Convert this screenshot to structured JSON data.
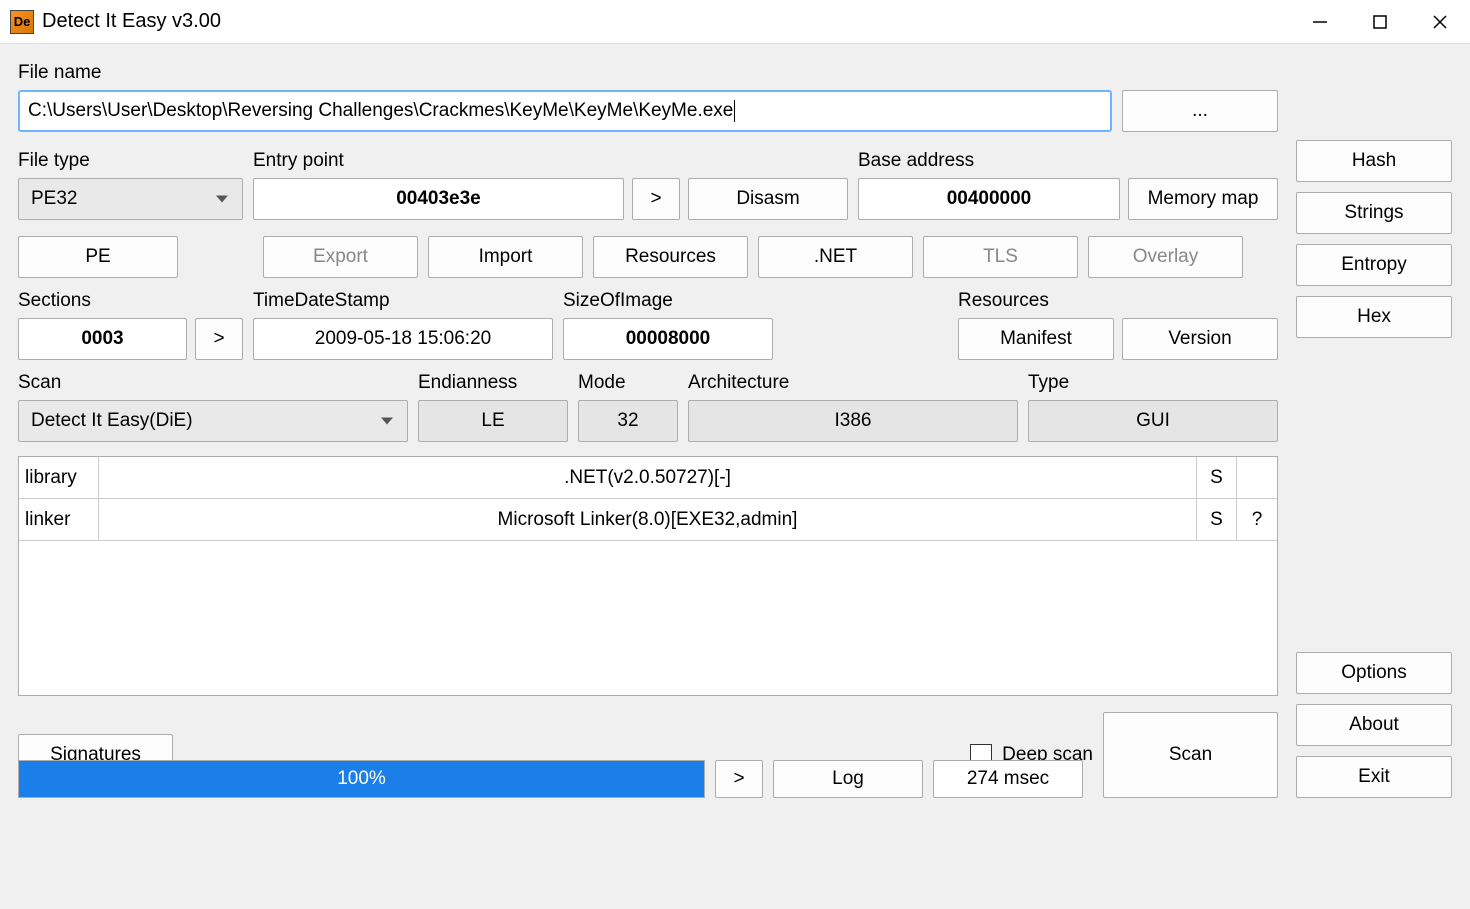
{
  "window": {
    "title": "Detect It Easy v3.00"
  },
  "filename_label": "File name",
  "filename_value": "C:\\Users\\User\\Desktop\\Reversing Challenges\\Crackmes\\KeyMe\\KeyMe\\KeyMe.exe",
  "browse_label": "...",
  "filetype_label": "File type",
  "filetype_value": "PE32",
  "entrypoint_label": "Entry point",
  "entrypoint_value": "00403e3e",
  "ep_more": ">",
  "disasm_label": "Disasm",
  "baseaddr_label": "Base address",
  "baseaddr_value": "00400000",
  "memmap_label": "Memory map",
  "pe_label": "PE",
  "export_label": "Export",
  "import_label": "Import",
  "resources_btn_label": "Resources",
  "net_label": ".NET",
  "tls_label": "TLS",
  "overlay_label": "Overlay",
  "sections_label": "Sections",
  "sections_value": "0003",
  "sections_more": ">",
  "timedate_label": "TimeDateStamp",
  "timedate_value": "2009-05-18 15:06:20",
  "sizeimg_label": "SizeOfImage",
  "sizeimg_value": "00008000",
  "resources_label": "Resources",
  "manifest_label": "Manifest",
  "version_label": "Version",
  "scan_label": "Scan",
  "scan_engine": "Detect It Easy(DiE)",
  "endian_label": "Endianness",
  "endian_value": "LE",
  "mode_label": "Mode",
  "mode_value": "32",
  "arch_label": "Architecture",
  "arch_value": "I386",
  "type_label": "Type",
  "type_value": "GUI",
  "scan_results": [
    {
      "category": "library",
      "name": ".NET(v2.0.50727)[-]",
      "s": "S",
      "q": ""
    },
    {
      "category": "linker",
      "name": "Microsoft Linker(8.0)[EXE32,admin]",
      "s": "S",
      "q": "?"
    }
  ],
  "signatures_label": "Signatures",
  "deepscan_label": "Deep scan",
  "scanbtn_label": "Scan",
  "progress_text": "100%",
  "progress_more": ">",
  "log_label": "Log",
  "elapsed_label": "274 msec",
  "side": {
    "hash": "Hash",
    "strings": "Strings",
    "entropy": "Entropy",
    "hex": "Hex",
    "options": "Options",
    "about": "About",
    "exit": "Exit"
  }
}
